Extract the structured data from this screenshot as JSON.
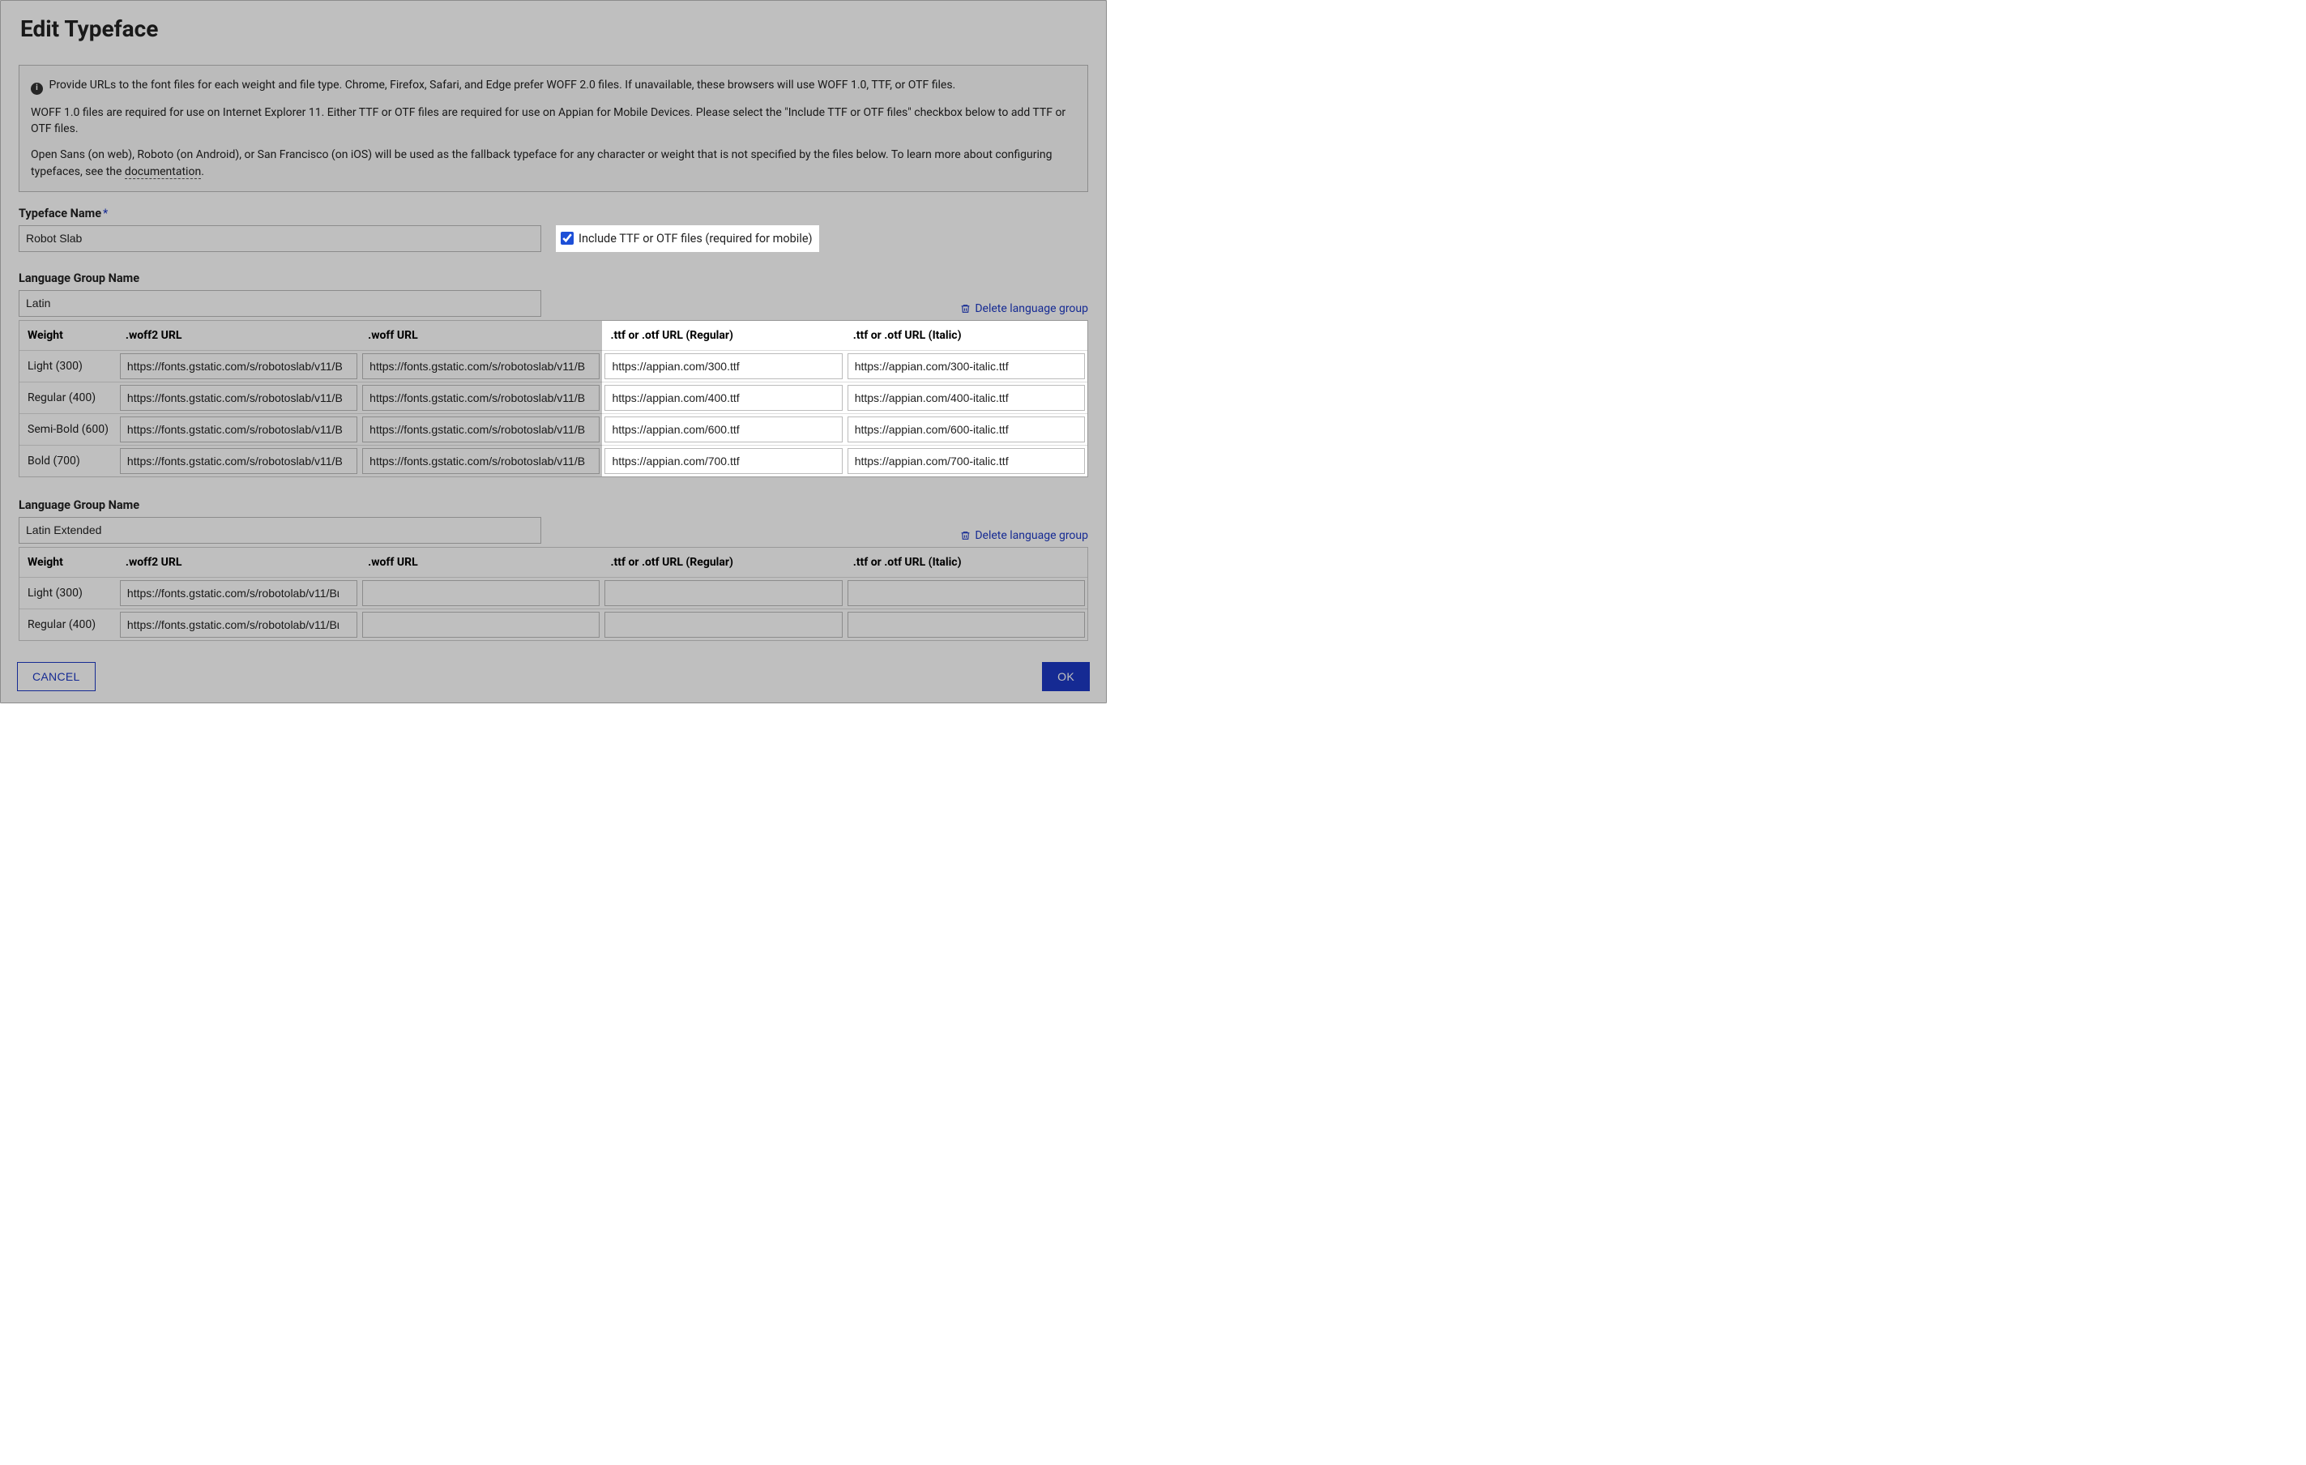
{
  "dialog": {
    "title": "Edit Typeface",
    "info": {
      "p1": "Provide URLs to the font files for each weight and file type. Chrome, Firefox, Safari, and Edge prefer WOFF 2.0 files. If unavailable, these browsers will use WOFF 1.0, TTF, or OTF files.",
      "p2": "WOFF 1.0 files are required for use on Internet Explorer 11. Either TTF or OTF files are required for use on Appian for Mobile Devices. Please select the \"Include TTF or OTF files\" checkbox below to add TTF or OTF files.",
      "p3_a": "Open Sans (on web), Roboto (on Android), or San Francisco (on iOS) will be used as the fallback typeface for any character or weight that is not specified by the files below. To learn more about configuring typefaces, see the ",
      "p3_doc": "documentation",
      "p3_b": "."
    },
    "typeface_name_label": "Typeface Name",
    "typeface_name_value": "Robot Slab",
    "include_ttf_label": "Include TTF or OTF files (required for mobile)",
    "include_ttf_checked": true,
    "language_group_label": "Language Group Name",
    "delete_group_label": "Delete language group",
    "columns": {
      "weight": "Weight",
      "woff2": ".woff2 URL",
      "woff": ".woff URL",
      "ttf_reg": ".ttf or .otf URL (Regular)",
      "ttf_ita": ".ttf or .otf URL (Italic)"
    },
    "groups": [
      {
        "name": "Latin",
        "rows": [
          {
            "weight": "Light (300)",
            "woff2": "https://fonts.gstatic.com/s/robotoslab/v11/B",
            "woff": "https://fonts.gstatic.com/s/robotoslab/v11/B",
            "ttf_reg": "https://appian.com/300.ttf",
            "ttf_ita": "https://appian.com/300-italic.ttf"
          },
          {
            "weight": "Regular (400)",
            "woff2": "https://fonts.gstatic.com/s/robotoslab/v11/B",
            "woff": "https://fonts.gstatic.com/s/robotoslab/v11/B",
            "ttf_reg": "https://appian.com/400.ttf",
            "ttf_ita": "https://appian.com/400-italic.ttf"
          },
          {
            "weight": "Semi-Bold (600)",
            "woff2": "https://fonts.gstatic.com/s/robotoslab/v11/B",
            "woff": "https://fonts.gstatic.com/s/robotoslab/v11/B",
            "ttf_reg": "https://appian.com/600.ttf",
            "ttf_ita": "https://appian.com/600-italic.ttf"
          },
          {
            "weight": "Bold (700)",
            "woff2": "https://fonts.gstatic.com/s/robotoslab/v11/B",
            "woff": "https://fonts.gstatic.com/s/robotoslab/v11/B",
            "ttf_reg": "https://appian.com/700.ttf",
            "ttf_ita": "https://appian.com/700-italic.ttf"
          }
        ]
      },
      {
        "name": "Latin Extended",
        "rows": [
          {
            "weight": "Light (300)",
            "woff2": "https://fonts.gstatic.com/s/robotolab/v11/Bι",
            "woff": "",
            "ttf_reg": "",
            "ttf_ita": ""
          },
          {
            "weight": "Regular (400)",
            "woff2": "https://fonts.gstatic.com/s/robotolab/v11/Bι",
            "woff": "",
            "ttf_reg": "",
            "ttf_ita": ""
          }
        ]
      }
    ],
    "cancel_label": "CANCEL",
    "ok_label": "OK"
  }
}
